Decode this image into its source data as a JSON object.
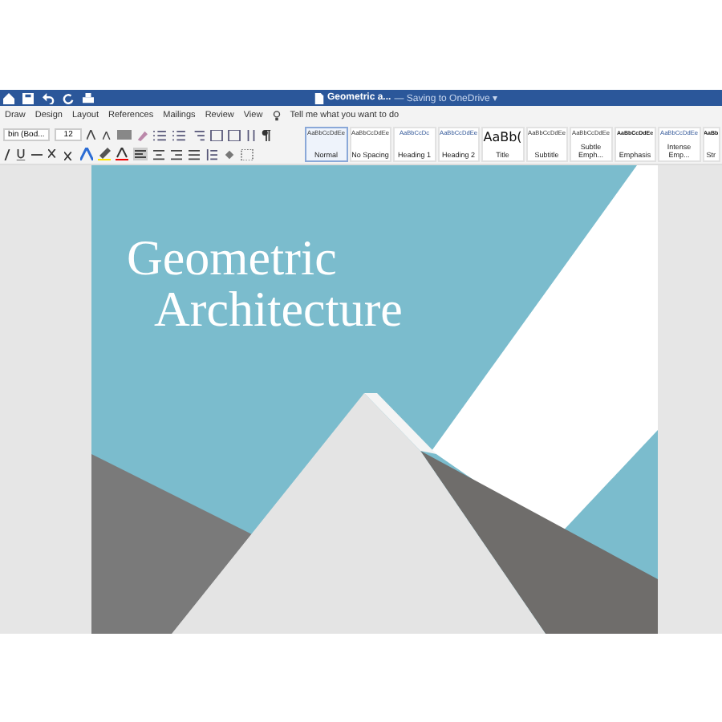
{
  "window": {
    "title": "Geometric a...",
    "status": "— Saving to OneDrive ▾"
  },
  "ribbon_tabs": [
    {
      "label": "Draw",
      "selected": false
    },
    {
      "label": "Design",
      "selected": false
    },
    {
      "label": "Layout",
      "selected": false
    },
    {
      "label": "References",
      "selected": false
    },
    {
      "label": "Mailings",
      "selected": false
    },
    {
      "label": "Review",
      "selected": false
    },
    {
      "label": "View",
      "selected": false
    }
  ],
  "tell_me": {
    "placeholder": "Tell me what you want to do"
  },
  "font": {
    "name": "bin (Bod...",
    "size": "12"
  },
  "styles": [
    {
      "preview": "AaBbCcDdEe",
      "name": "Normal",
      "selected": true,
      "kind": "body"
    },
    {
      "preview": "AaBbCcDdEe",
      "name": "No Spacing",
      "selected": false,
      "kind": "body"
    },
    {
      "preview": "AaBbCcDc",
      "name": "Heading 1",
      "selected": false,
      "kind": "heading"
    },
    {
      "preview": "AaBbCcDdEe",
      "name": "Heading 2",
      "selected": false,
      "kind": "heading"
    },
    {
      "preview": "AaBb(",
      "name": "Title",
      "selected": false,
      "kind": "title"
    },
    {
      "preview": "AaBbCcDdEe",
      "name": "Subtitle",
      "selected": false,
      "kind": "body"
    },
    {
      "preview": "AaBbCcDdEe",
      "name": "Subtle Emph...",
      "selected": false,
      "kind": "body"
    },
    {
      "preview": "AaBbCcDdEe",
      "name": "Emphasis",
      "selected": false,
      "kind": "strong"
    },
    {
      "preview": "AaBbCcDdEe",
      "name": "Intense Emp...",
      "selected": false,
      "kind": "accent"
    },
    {
      "preview": "AaBb",
      "name": "Str",
      "selected": false,
      "kind": "strong"
    }
  ],
  "document": {
    "title_lines": [
      "Geometric",
      "Architecture"
    ]
  }
}
